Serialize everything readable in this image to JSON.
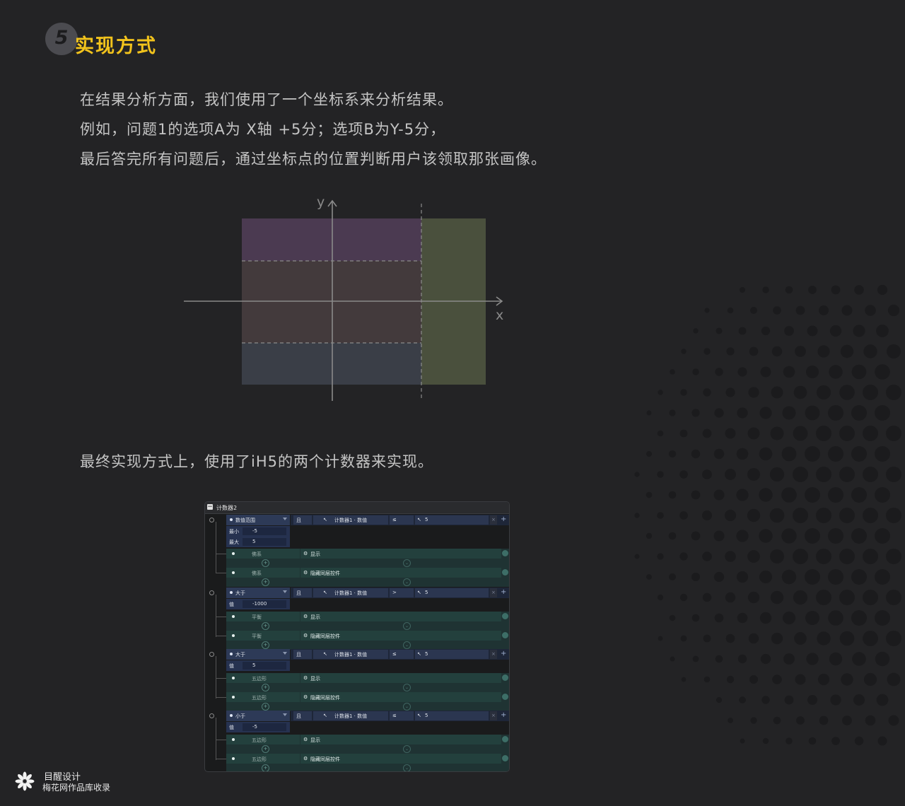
{
  "section": {
    "number": "5",
    "title": "实现方式"
  },
  "intro": {
    "lines": [
      "在结果分析方面，我们使用了一个坐标系来分析结果。",
      "例如，问题1的选项A为 X轴 +5分；选项B为Y-5分，",
      "最后答完所有问题后，通过坐标点的位置判断用户该领取那张画像。"
    ]
  },
  "diagram": {
    "y_label": "y",
    "x_label": "x",
    "colors": {
      "purple": "#4b3a51",
      "brown": "#433a3c",
      "slate": "#3a3e47",
      "olive": "#4a503d"
    }
  },
  "implementation": {
    "text": "最终实现方式上，使用了iH5的两个计数器来实现。"
  },
  "counter_panel": {
    "title": "计数器2",
    "and_label": "且",
    "target": "计数器1 · 数值",
    "action_show": "显示",
    "action_hide": "隐藏同层控件",
    "rules": [
      {
        "condition": "数值范围",
        "operator": "≤",
        "compare_value": "5",
        "params": [
          {
            "key": "最小",
            "value": "-5"
          },
          {
            "key": "最大",
            "value": "5"
          }
        ],
        "object": "佛系"
      },
      {
        "condition": "大于",
        "operator": ">",
        "compare_value": "5",
        "params": [
          {
            "key": "值",
            "value": "-1000"
          }
        ],
        "object": "平衡"
      },
      {
        "condition": "大于",
        "operator": "≤",
        "compare_value": "5",
        "params": [
          {
            "key": "值",
            "value": "5"
          }
        ],
        "object": "五边形"
      },
      {
        "condition": "小于",
        "operator": "≤",
        "compare_value": "5",
        "params": [
          {
            "key": "值",
            "value": "-5"
          }
        ],
        "object": "五边形"
      }
    ]
  },
  "footer": {
    "brand": "目醒设计",
    "source": "梅花网作品库收录"
  }
}
